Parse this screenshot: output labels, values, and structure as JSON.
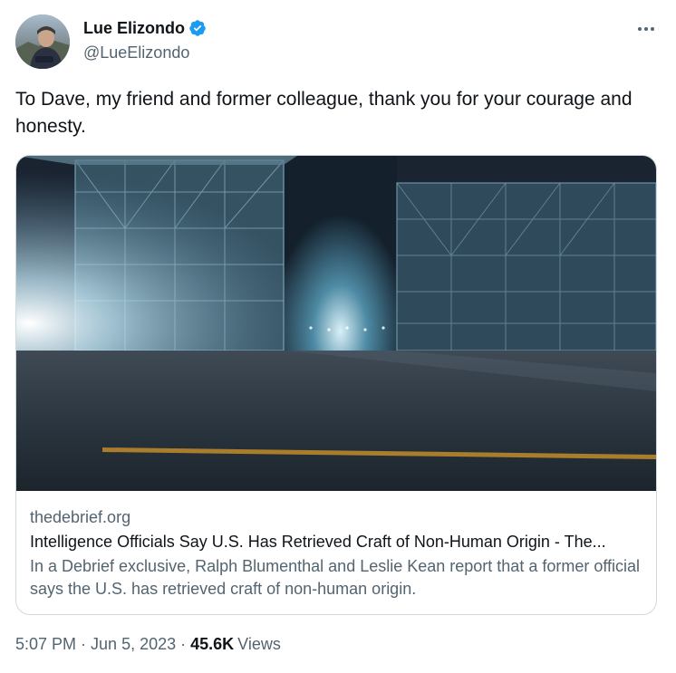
{
  "author": {
    "display_name": "Lue Elizondo",
    "handle": "@LueElizondo",
    "verified_color": "#1d9bf0"
  },
  "tweet": {
    "text": "To Dave, my friend and former colleague, thank you for your courage and honesty.",
    "time": "5:07 PM",
    "separator": "·",
    "date": "Jun 5, 2023",
    "views_count": "45.6K",
    "views_label": "Views"
  },
  "card": {
    "domain": "thedebrief.org",
    "title": "Intelligence Officials Say U.S. Has Retrieved Craft of Non-Human Origin - The...",
    "description": "In a Debrief exclusive, Ralph Blumenthal and Leslie Kean report that a former official says the U.S. has retrieved craft of non-human origin."
  },
  "icons": {
    "verified": "verified-badge-icon",
    "more": "more-options-icon"
  },
  "colors": {
    "text": "#0f1419",
    "secondary": "#536471",
    "border": "#cfd9de"
  }
}
